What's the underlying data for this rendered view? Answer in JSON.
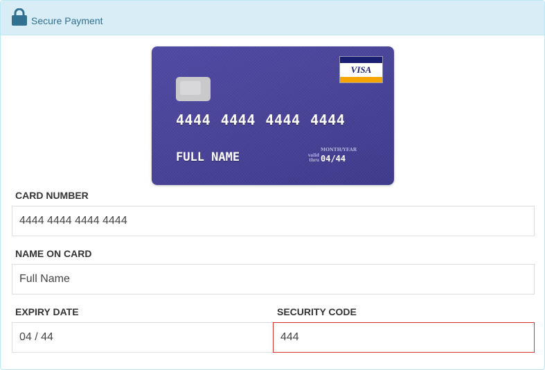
{
  "panel": {
    "title": "Secure Payment",
    "icon": "lock-icon"
  },
  "card_preview": {
    "number": "4444 4444 4444 4444",
    "name": "FULL NAME",
    "valid_thru_line1": "valid",
    "valid_thru_line2": "thru",
    "month_year_label": "MONTH/YEAR",
    "expiry": "04/44",
    "brand": "VISA",
    "colors": {
      "card": "#4a4499",
      "visa_blue": "#1a1f71",
      "visa_gold": "#f7a600"
    }
  },
  "form": {
    "card_number": {
      "label": "CARD NUMBER",
      "value": "4444 4444 4444 4444"
    },
    "name_on_card": {
      "label": "NAME ON CARD",
      "value": "Full Name"
    },
    "expiry_date": {
      "label": "EXPIRY DATE",
      "value": "04 / 44"
    },
    "security_code": {
      "label": "SECURITY CODE",
      "value": "444",
      "state": "error"
    }
  },
  "colors": {
    "heading_bg": "#d9edf7",
    "heading_text": "#31708f",
    "error_border": "#d9322b"
  }
}
